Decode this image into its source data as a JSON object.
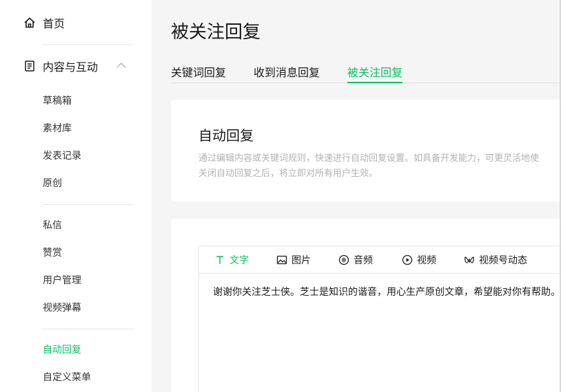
{
  "sidebar": {
    "home": {
      "label": "首页",
      "icon": "home-icon"
    },
    "content": {
      "label": "内容与互动",
      "icon": "document-icon",
      "expanded": true
    },
    "group1": [
      "草稿箱",
      "素材库",
      "发表记录",
      "原创"
    ],
    "group2": [
      "私信",
      "赞赏",
      "用户管理",
      "视频弹幕"
    ],
    "group3": [
      "自动回复",
      "自定义菜单"
    ],
    "active_item": "自动回复"
  },
  "page": {
    "title": "被关注回复"
  },
  "tabs": [
    {
      "label": "关键词回复"
    },
    {
      "label": "收到消息回复"
    },
    {
      "label": "被关注回复",
      "active": true
    }
  ],
  "auto_reply": {
    "title": "自动回复",
    "desc_line1": "通过编辑内容或关键词规则，快速进行自动回复设置。如具备开发能力，可更灵活地使",
    "desc_line2": "关闭自动回复之后，将立即对所有用户生效。"
  },
  "editor": {
    "tools": [
      {
        "label": "文字",
        "icon": "text-icon",
        "active": true
      },
      {
        "label": "图片",
        "icon": "image-icon"
      },
      {
        "label": "音频",
        "icon": "audio-icon"
      },
      {
        "label": "视频",
        "icon": "video-icon"
      },
      {
        "label": "视频号动态",
        "icon": "channels-icon"
      }
    ],
    "content": "谢谢你关注芝士侠。芝士是知识的谐音，用心生产原创文章，希望能对你有帮助。"
  },
  "colors": {
    "accent": "#07c160",
    "muted": "#b2b2b2"
  }
}
